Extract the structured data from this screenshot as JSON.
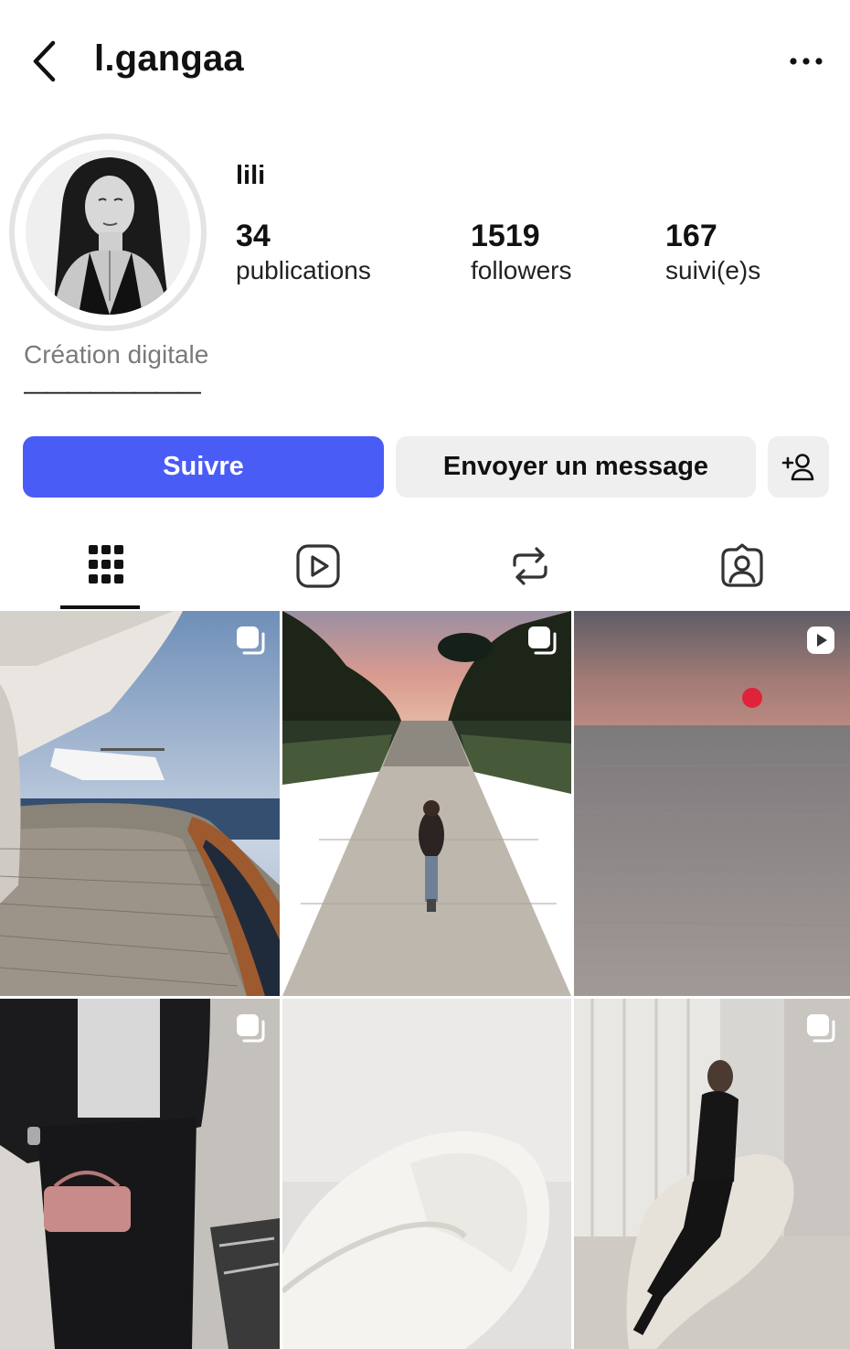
{
  "header": {
    "username": "l.gangaa",
    "back_icon": "chevron-left-icon",
    "more_icon": "more-horizontal-icon"
  },
  "profile": {
    "display_name": "lili",
    "stats": [
      {
        "value": "34",
        "label": "publications"
      },
      {
        "value": "1519",
        "label": "followers"
      },
      {
        "value": "167",
        "label": "suivi(e)s"
      }
    ],
    "category": "Création digitale",
    "bio": "————————"
  },
  "actions": {
    "follow_label": "Suivre",
    "message_label": "Envoyer un message",
    "add_user_icon": "add-user-icon"
  },
  "tabs": [
    {
      "name": "grid",
      "icon": "grid-icon",
      "active": true
    },
    {
      "name": "reels",
      "icon": "reels-icon",
      "active": false
    },
    {
      "name": "reposts",
      "icon": "repost-icon",
      "active": false
    },
    {
      "name": "tagged",
      "icon": "tagged-icon",
      "active": false
    }
  ],
  "posts": [
    {
      "scene": "yacht deck with helicopter",
      "badge": "carousel"
    },
    {
      "scene": "woman walking down garden path at sunset",
      "badge": "carousel"
    },
    {
      "scene": "sea sunset",
      "badge": "reel"
    },
    {
      "scene": "mirror outfit with pink bag",
      "badge": "carousel"
    },
    {
      "scene": "white boucle chair close-up",
      "badge": "none"
    },
    {
      "scene": "woman on curved sofa",
      "badge": "carousel"
    }
  ],
  "colors": {
    "accent": "#4a5cf6",
    "secondary_button": "#efefef",
    "muted_text": "#7a7a7a"
  }
}
